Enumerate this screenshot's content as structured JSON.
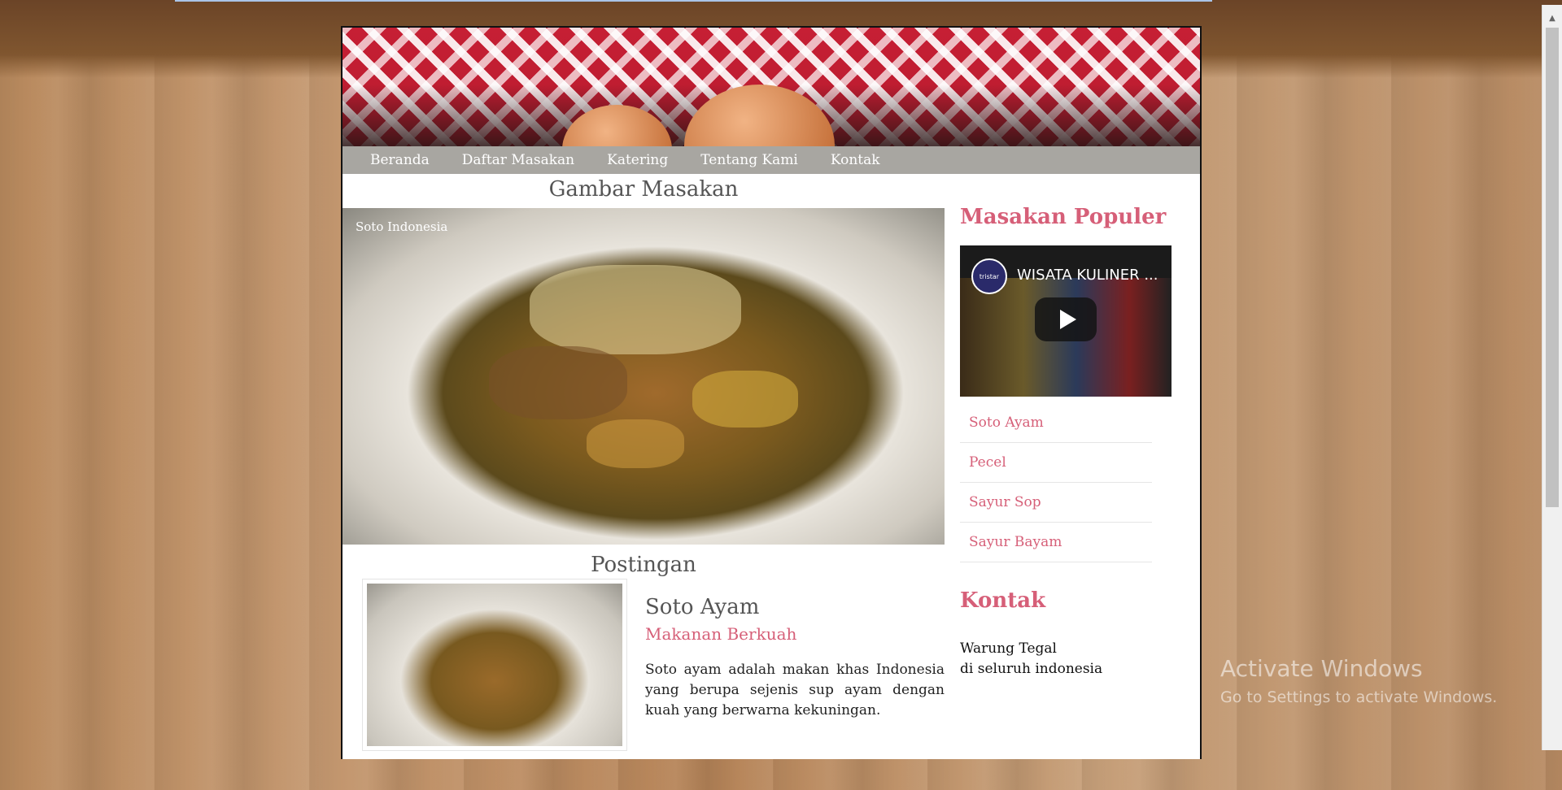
{
  "nav": {
    "items": [
      "Beranda",
      "Daftar Masakan",
      "Katering",
      "Tentang Kami",
      "Kontak"
    ]
  },
  "main": {
    "gallery_title": "Gambar Masakan",
    "hero_caption": "Soto Indonesia",
    "posts_title": "Postingan",
    "post": {
      "title": "Soto Ayam",
      "subtitle": "Makanan Berkuah",
      "body": "Soto ayam adalah makan khas Indonesia yang berupa sejenis sup ayam dengan kuah yang berwarna kekuningan."
    }
  },
  "sidebar": {
    "popular_title": "Masakan Populer",
    "video": {
      "title": "WISATA KULINER ...",
      "channel_badge": "tristar"
    },
    "popular_items": [
      "Soto Ayam",
      "Pecel",
      "Sayur Sop",
      "Sayur Bayam"
    ],
    "contact_title": "Kontak",
    "contact_lines": [
      "Warung Tegal",
      "di seluruh indonesia"
    ]
  },
  "os_watermark": {
    "line1": "Activate Windows",
    "line2": "Go to Settings to activate Windows."
  },
  "colors": {
    "accent_pink": "#d65f78",
    "nav_bg": "#a8a6a1",
    "heading_gray": "#555555"
  }
}
